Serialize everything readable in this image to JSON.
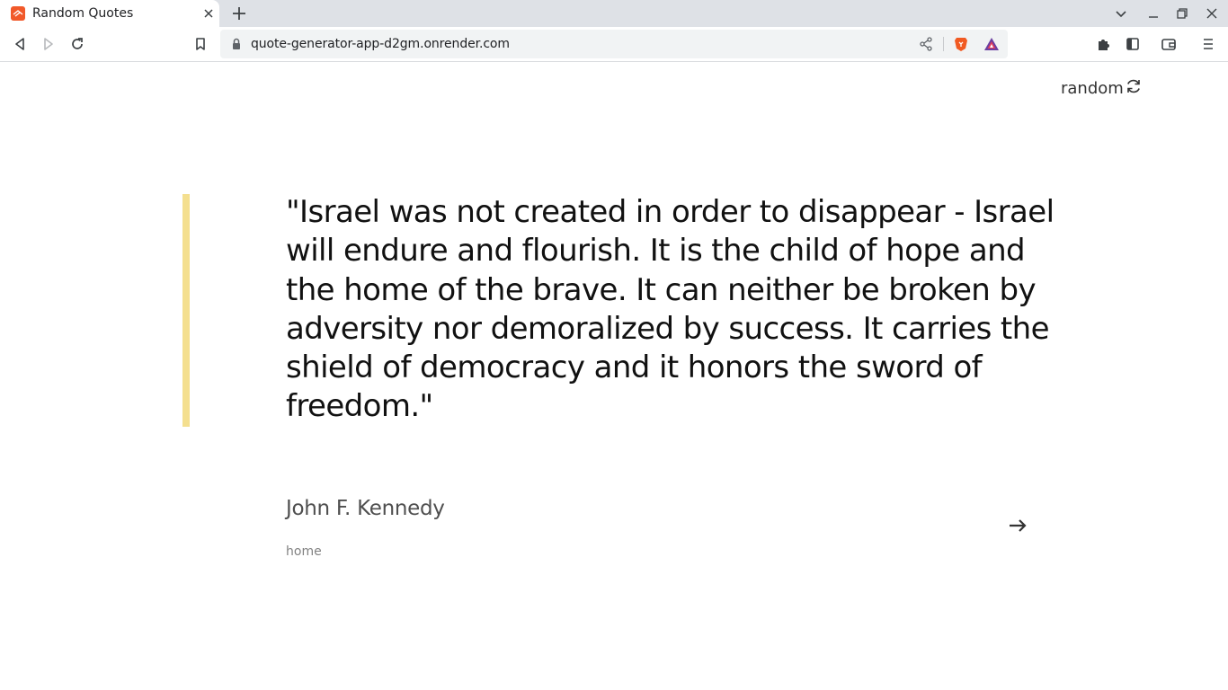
{
  "browser": {
    "tab": {
      "title": "Random Quotes"
    },
    "url": "quote-generator-app-d2gm.onrender.com"
  },
  "page": {
    "random_label": "random",
    "quote": "\"Israel was not created in order to disappear - Israel will endure and flourish. It is the child of hope and the home of the brave. It can neither be broken by adversity nor demoralized by success. It carries the shield of democracy and it honors the sword of freedom.\"",
    "author": "John F. Kennedy",
    "genre": "home"
  },
  "colors": {
    "accent_bar": "#f4df8f",
    "favicon": "#f1592a",
    "brave_lion": "#f15a22"
  }
}
